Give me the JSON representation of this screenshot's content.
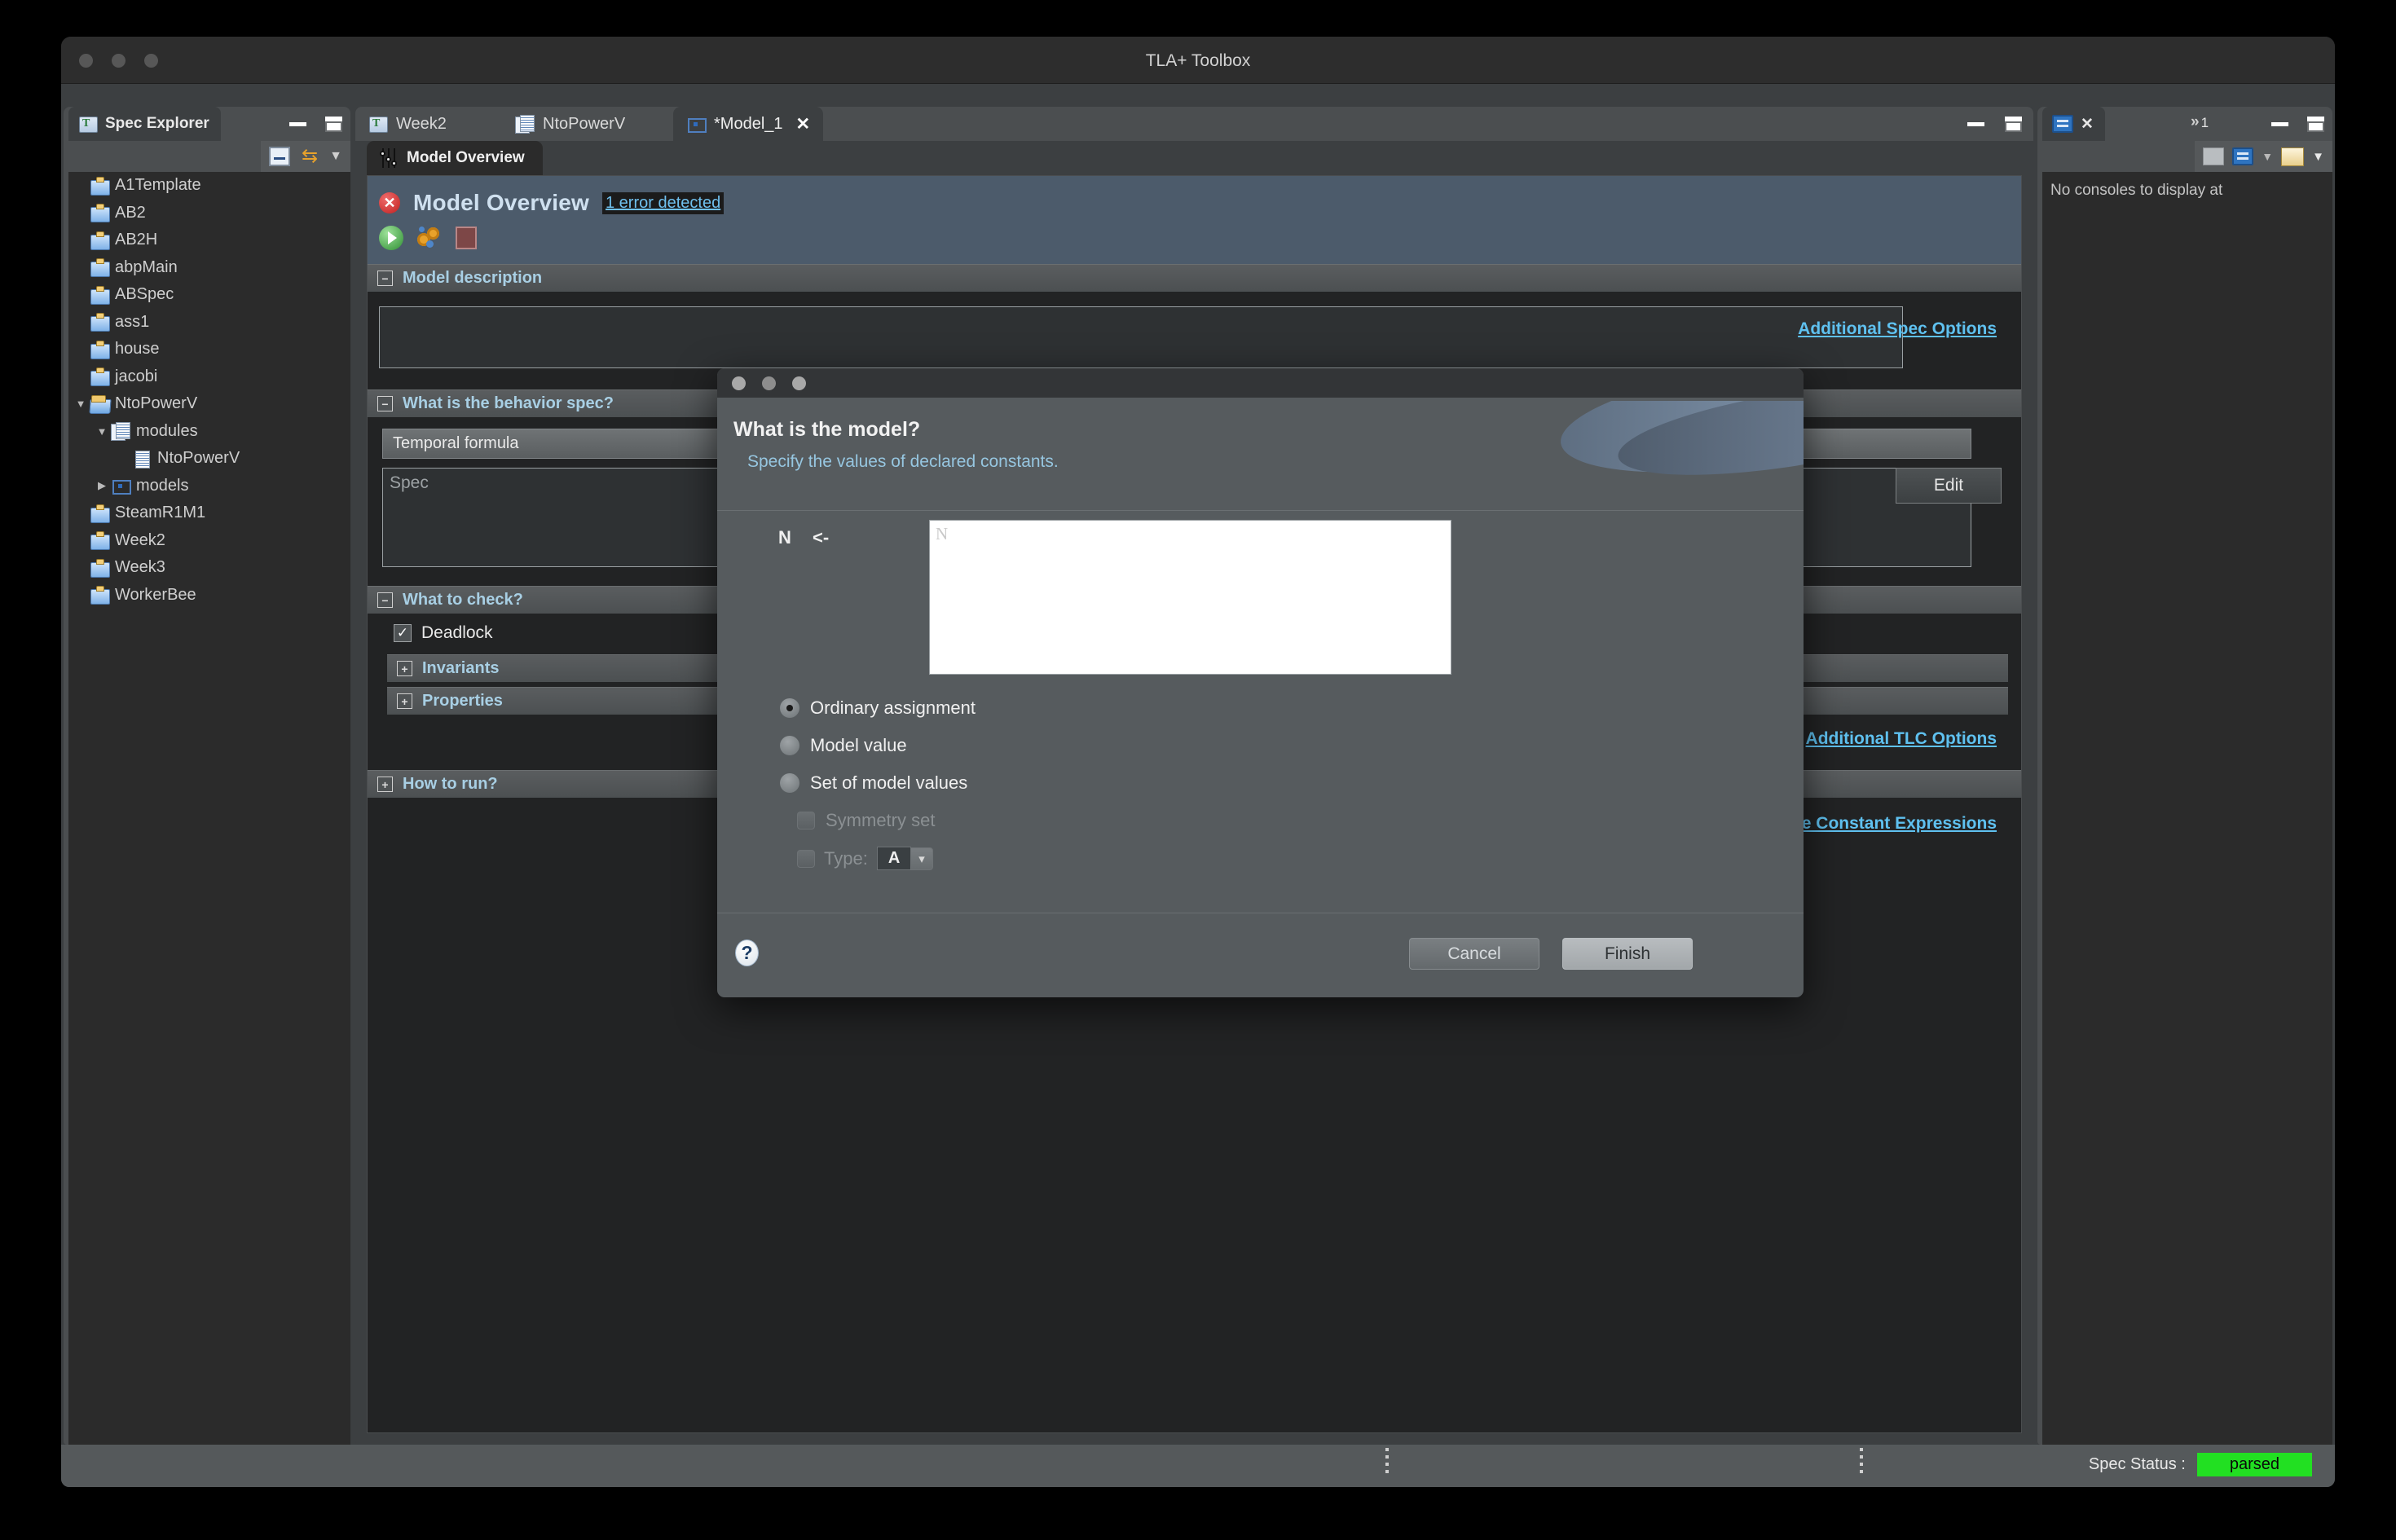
{
  "window": {
    "title": "TLA+ Toolbox"
  },
  "spec_explorer": {
    "tab_label": "Spec Explorer",
    "tab_icon": "tla-spec-icon",
    "toolbar": {
      "collapse_icon": "collapse-all-icon",
      "link_icon": "link-with-editor-icon",
      "menu_icon": "view-menu-icon"
    },
    "items": [
      {
        "label": "A1Template",
        "icon": "spec-icon",
        "indent": 1,
        "twisty": ""
      },
      {
        "label": "AB2",
        "icon": "spec-icon",
        "indent": 1,
        "twisty": ""
      },
      {
        "label": "AB2H",
        "icon": "spec-icon",
        "indent": 1,
        "twisty": ""
      },
      {
        "label": "abpMain",
        "icon": "spec-icon",
        "indent": 1,
        "twisty": ""
      },
      {
        "label": "ABSpec",
        "icon": "spec-icon",
        "indent": 1,
        "twisty": ""
      },
      {
        "label": "ass1",
        "icon": "spec-icon",
        "indent": 1,
        "twisty": ""
      },
      {
        "label": "house",
        "icon": "spec-icon",
        "indent": 1,
        "twisty": ""
      },
      {
        "label": "jacobi",
        "icon": "spec-icon",
        "indent": 1,
        "twisty": ""
      },
      {
        "label": "NtoPowerV",
        "icon": "spec-open-icon",
        "indent": 1,
        "twisty": "▼"
      },
      {
        "label": "modules",
        "icon": "modules-icon",
        "indent": 2,
        "twisty": "▼"
      },
      {
        "label": "NtoPowerV",
        "icon": "module-doc-icon",
        "indent": 3,
        "twisty": ""
      },
      {
        "label": "models",
        "icon": "model-icon",
        "indent": 2,
        "twisty": "▶"
      },
      {
        "label": "SteamR1M1",
        "icon": "spec-icon",
        "indent": 1,
        "twisty": ""
      },
      {
        "label": "Week2",
        "icon": "spec-icon",
        "indent": 1,
        "twisty": ""
      },
      {
        "label": "Week3",
        "icon": "spec-icon",
        "indent": 1,
        "twisty": ""
      },
      {
        "label": "WorkerBee",
        "icon": "spec-icon",
        "indent": 1,
        "twisty": ""
      }
    ]
  },
  "editor": {
    "tabs": [
      {
        "label": "Week2",
        "icon": "spec-file-icon",
        "active": false,
        "closable": false
      },
      {
        "label": "NtoPowerV",
        "icon": "module-icon",
        "active": false,
        "closable": false
      },
      {
        "label": "*Model_1",
        "icon": "model-icon",
        "active": true,
        "closable": true,
        "close_glyph": "✕"
      }
    ],
    "form_tab_label": "Model Overview",
    "form_tab_icon": "sliders-icon",
    "header": {
      "title": "Model Overview",
      "status_icon": "error-icon",
      "error_link": "1 error detected",
      "actions": [
        {
          "name": "run-model-button",
          "icon": "run-green-icon"
        },
        {
          "name": "run-simulation-button",
          "icon": "gears-icon"
        },
        {
          "name": "stop-button",
          "icon": "stop-icon"
        }
      ]
    },
    "sections": [
      {
        "label": "Model description",
        "expander": "−"
      },
      {
        "label": "What is the behavior spec?",
        "expander": "−"
      },
      {
        "label": "What to check?",
        "expander": "−"
      },
      {
        "label": "How to run?",
        "expander": "+"
      }
    ],
    "behavior": {
      "combo_value": "Temporal formula",
      "formula_value": "Spec"
    },
    "spec_options_link": "Additional Spec Options",
    "edit_button": "Edit",
    "check": {
      "deadlock_label": "Deadlock",
      "deadlock_checked": true,
      "check_mark": "✓",
      "invariants_label": "Invariants",
      "invariants_expander": "+",
      "properties_label": "Properties",
      "properties_expander": "+"
    },
    "tlc_options_link": "Additional TLC Options",
    "evaluate_link": "Evaluate Constant Expressions"
  },
  "console": {
    "tab_icon": "console-monitor-icon",
    "close_glyph": "✕",
    "overflow_glyph": "»",
    "overflow_count": "1",
    "toolbar": {
      "pin_icon": "pin-console-icon",
      "display_icon": "display-selected-console-icon",
      "open_icon": "open-console-icon",
      "dropdown_glyph": "▾"
    },
    "message": "No consoles to display at"
  },
  "statusbar": {
    "spec_status_label": "Spec Status :",
    "spec_status_value": "parsed",
    "spec_status_color": "#22e022"
  },
  "dialog": {
    "title_buttons": [
      "close",
      "minimize",
      "zoom"
    ],
    "heading": "What is the model?",
    "subheading": "Specify the values of declared constants.",
    "constant_name": "N",
    "assignment_arrow": "<-",
    "value_placeholder": "N",
    "value": "",
    "options": [
      {
        "label": "Ordinary assignment",
        "selected": true,
        "disabled": false
      },
      {
        "label": "Model value",
        "selected": false,
        "disabled": false
      },
      {
        "label": "Set of model values",
        "selected": false,
        "disabled": false
      }
    ],
    "symmetry_label": "Symmetry set",
    "symmetry_checked": false,
    "type_label": "Type:",
    "type_value": "A",
    "type_arrow": "▾",
    "help_glyph": "?",
    "cancel_label": "Cancel",
    "finish_label": "Finish"
  }
}
